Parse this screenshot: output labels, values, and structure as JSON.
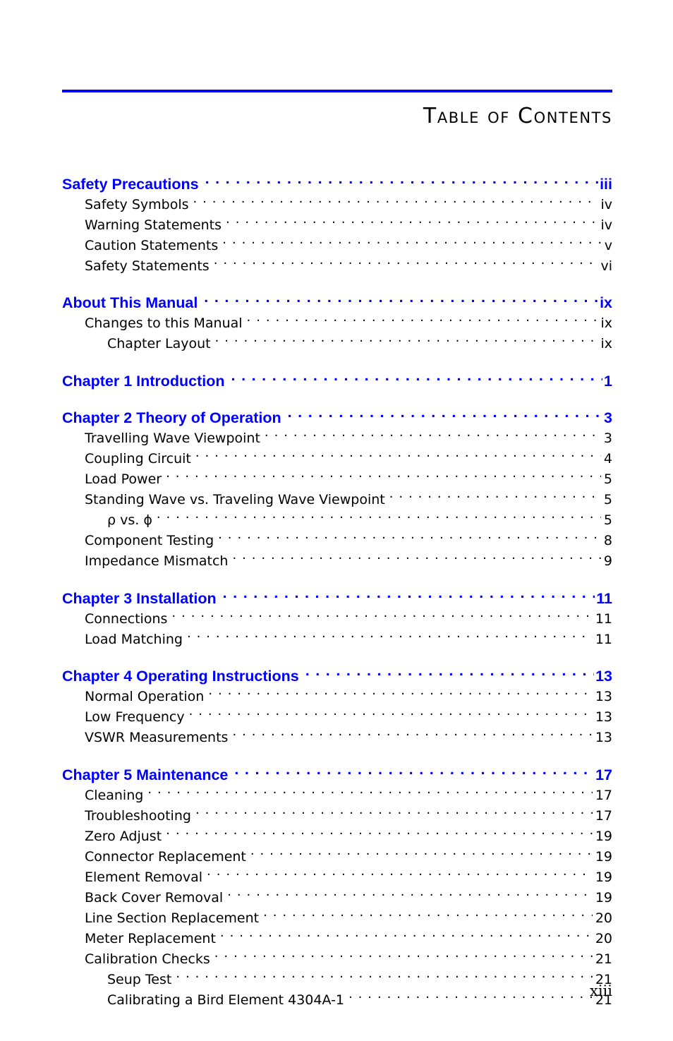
{
  "header": {
    "title": "Table of Contents",
    "rule_color": "#0000ff"
  },
  "colors": {
    "heading": "#0000ff",
    "entry": "#000000",
    "rule": "#0000ff"
  },
  "footer": {
    "page_number": "xiii"
  },
  "toc": {
    "entries": [
      {
        "level": 0,
        "label": "Safety Precautions",
        "page": "iii"
      },
      {
        "level": 1,
        "label": "Safety Symbols",
        "page": "iv"
      },
      {
        "level": 1,
        "label": "Warning Statements",
        "page": "iv"
      },
      {
        "level": 1,
        "label": "Caution Statements",
        "page": "v"
      },
      {
        "level": 1,
        "label": "Safety Statements",
        "page": "vi"
      },
      {
        "level": 0,
        "label": "About This Manual",
        "page": "ix"
      },
      {
        "level": 1,
        "label": "Changes to this Manual",
        "page": "ix"
      },
      {
        "level": 2,
        "label": "Chapter Layout",
        "page": "ix"
      },
      {
        "level": 0,
        "label": "Chapter 1  Introduction",
        "page": "1"
      },
      {
        "level": 0,
        "label": "Chapter 2  Theory of Operation",
        "page": "3"
      },
      {
        "level": 1,
        "label": "Travelling Wave Viewpoint",
        "page": "3"
      },
      {
        "level": 1,
        "label": "Coupling Circuit",
        "page": "4"
      },
      {
        "level": 1,
        "label": "Load Power",
        "page": "5"
      },
      {
        "level": 1,
        "label": "Standing Wave vs. Traveling Wave Viewpoint",
        "page": "5"
      },
      {
        "level": 2,
        "label": "ρ vs. ϕ",
        "page": "5"
      },
      {
        "level": 1,
        "label": "Component Testing",
        "page": "8"
      },
      {
        "level": 1,
        "label": "Impedance Mismatch",
        "page": "9"
      },
      {
        "level": 0,
        "label": "Chapter 3  Installation",
        "page": "11"
      },
      {
        "level": 1,
        "label": "Connections",
        "page": "11"
      },
      {
        "level": 1,
        "label": "Load Matching",
        "page": "11"
      },
      {
        "level": 0,
        "label": "Chapter 4  Operating Instructions",
        "page": "13"
      },
      {
        "level": 1,
        "label": "Normal Operation",
        "page": "13"
      },
      {
        "level": 1,
        "label": "Low Frequency",
        "page": "13"
      },
      {
        "level": 1,
        "label": "VSWR Measurements",
        "page": "13"
      },
      {
        "level": 0,
        "label": "Chapter 5  Maintenance",
        "page": "17"
      },
      {
        "level": 1,
        "label": "Cleaning",
        "page": "17"
      },
      {
        "level": 1,
        "label": "Troubleshooting",
        "page": "17"
      },
      {
        "level": 1,
        "label": "Zero Adjust",
        "page": "19"
      },
      {
        "level": 1,
        "label": "Connector Replacement",
        "page": "19"
      },
      {
        "level": 1,
        "label": "Element Removal",
        "page": "19"
      },
      {
        "level": 1,
        "label": "Back Cover Removal",
        "page": "19"
      },
      {
        "level": 1,
        "label": "Line Section Replacement",
        "page": "20"
      },
      {
        "level": 1,
        "label": "Meter Replacement",
        "page": "20"
      },
      {
        "level": 1,
        "label": "Calibration Checks",
        "page": "21"
      },
      {
        "level": 2,
        "label": "Seup Test",
        "page": "21"
      },
      {
        "level": 2,
        "label": "Calibrating a Bird Element 4304A-1",
        "page": "21"
      }
    ]
  }
}
